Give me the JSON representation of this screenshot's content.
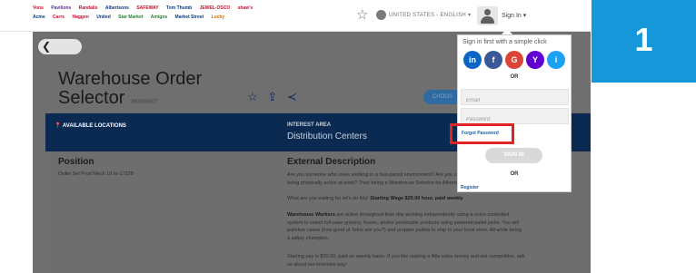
{
  "header": {
    "brands_row1": [
      "Vons",
      "Pavilions",
      "Randalls",
      "Albertsons",
      "SAFEWAY",
      "Tom Thumb",
      "JEWEL-OSCO",
      "shaw's"
    ],
    "brands_row2": [
      "Acme",
      "Carrs",
      "Haggen",
      "United",
      "Star Market",
      "Amigos",
      "Market Street",
      "Lucky"
    ],
    "region": "UNITED STATES - ENGLISH",
    "sign_in": "Sign In",
    "colors": {
      "accent": "#1597d9",
      "brand_dark": "#0b2a52"
    }
  },
  "tile": {
    "number": "1"
  },
  "job": {
    "title_line1": "Warehouse Order",
    "title_line2": "Selector",
    "code": "JR0000007",
    "choose_label": "CHOOS",
    "available_locations_label": "AVAILABLE LOCATIONS",
    "interest_area_label": "INTEREST AREA",
    "interest_area_value": "Distribution Centers",
    "position_heading": "Position",
    "position_value": "Order Sel Prod Mech 10 hr-17228",
    "external_heading": "External Description",
    "para1": "Are you someone who loves working in a fast-paced environment? Are you competitive? Do you enjoy being physically active at work? Then being a Warehouse Selector for Albertsons is the right role for you!",
    "para2_prefix": "What are you waiting for let's do this!",
    "para2_bold": "Starting Wage $20.00 hour, paid weekly",
    "para3_bold": "Warehouse Workers",
    "para3_rest": "are active throughout their day working independently using a voice-controlled system to select full-case grocery, frozen, and/or perishable products using powered pallet jacks. You will palletize cases (how good at Tetris are you?) and prepare pallets to ship to your local store. All while being a safety champion.",
    "para4": "Starting pay is $20.00, paid on weekly basis. If you like making a little extra money and are competitive, ask us about our incentive pay!"
  },
  "signin_popup": {
    "heading": "Sign in first with a simple click",
    "social": [
      {
        "name": "linkedin-icon",
        "glyph": "in",
        "color": "#0a66c2"
      },
      {
        "name": "facebook-icon",
        "glyph": "f",
        "color": "#3b5998"
      },
      {
        "name": "google-icon",
        "glyph": "G",
        "color": "#db4437"
      },
      {
        "name": "yahoo-icon",
        "glyph": "Y",
        "color": "#6001d2"
      },
      {
        "name": "info-icon",
        "glyph": "i",
        "color": "#1da1f2"
      }
    ],
    "or_label": "OR",
    "email_placeholder": "Email",
    "password_placeholder": "Password",
    "forgot_password": "Forgot Password",
    "signin_button": "SIGN IN",
    "or_label_2": "OR",
    "register": "Register"
  }
}
